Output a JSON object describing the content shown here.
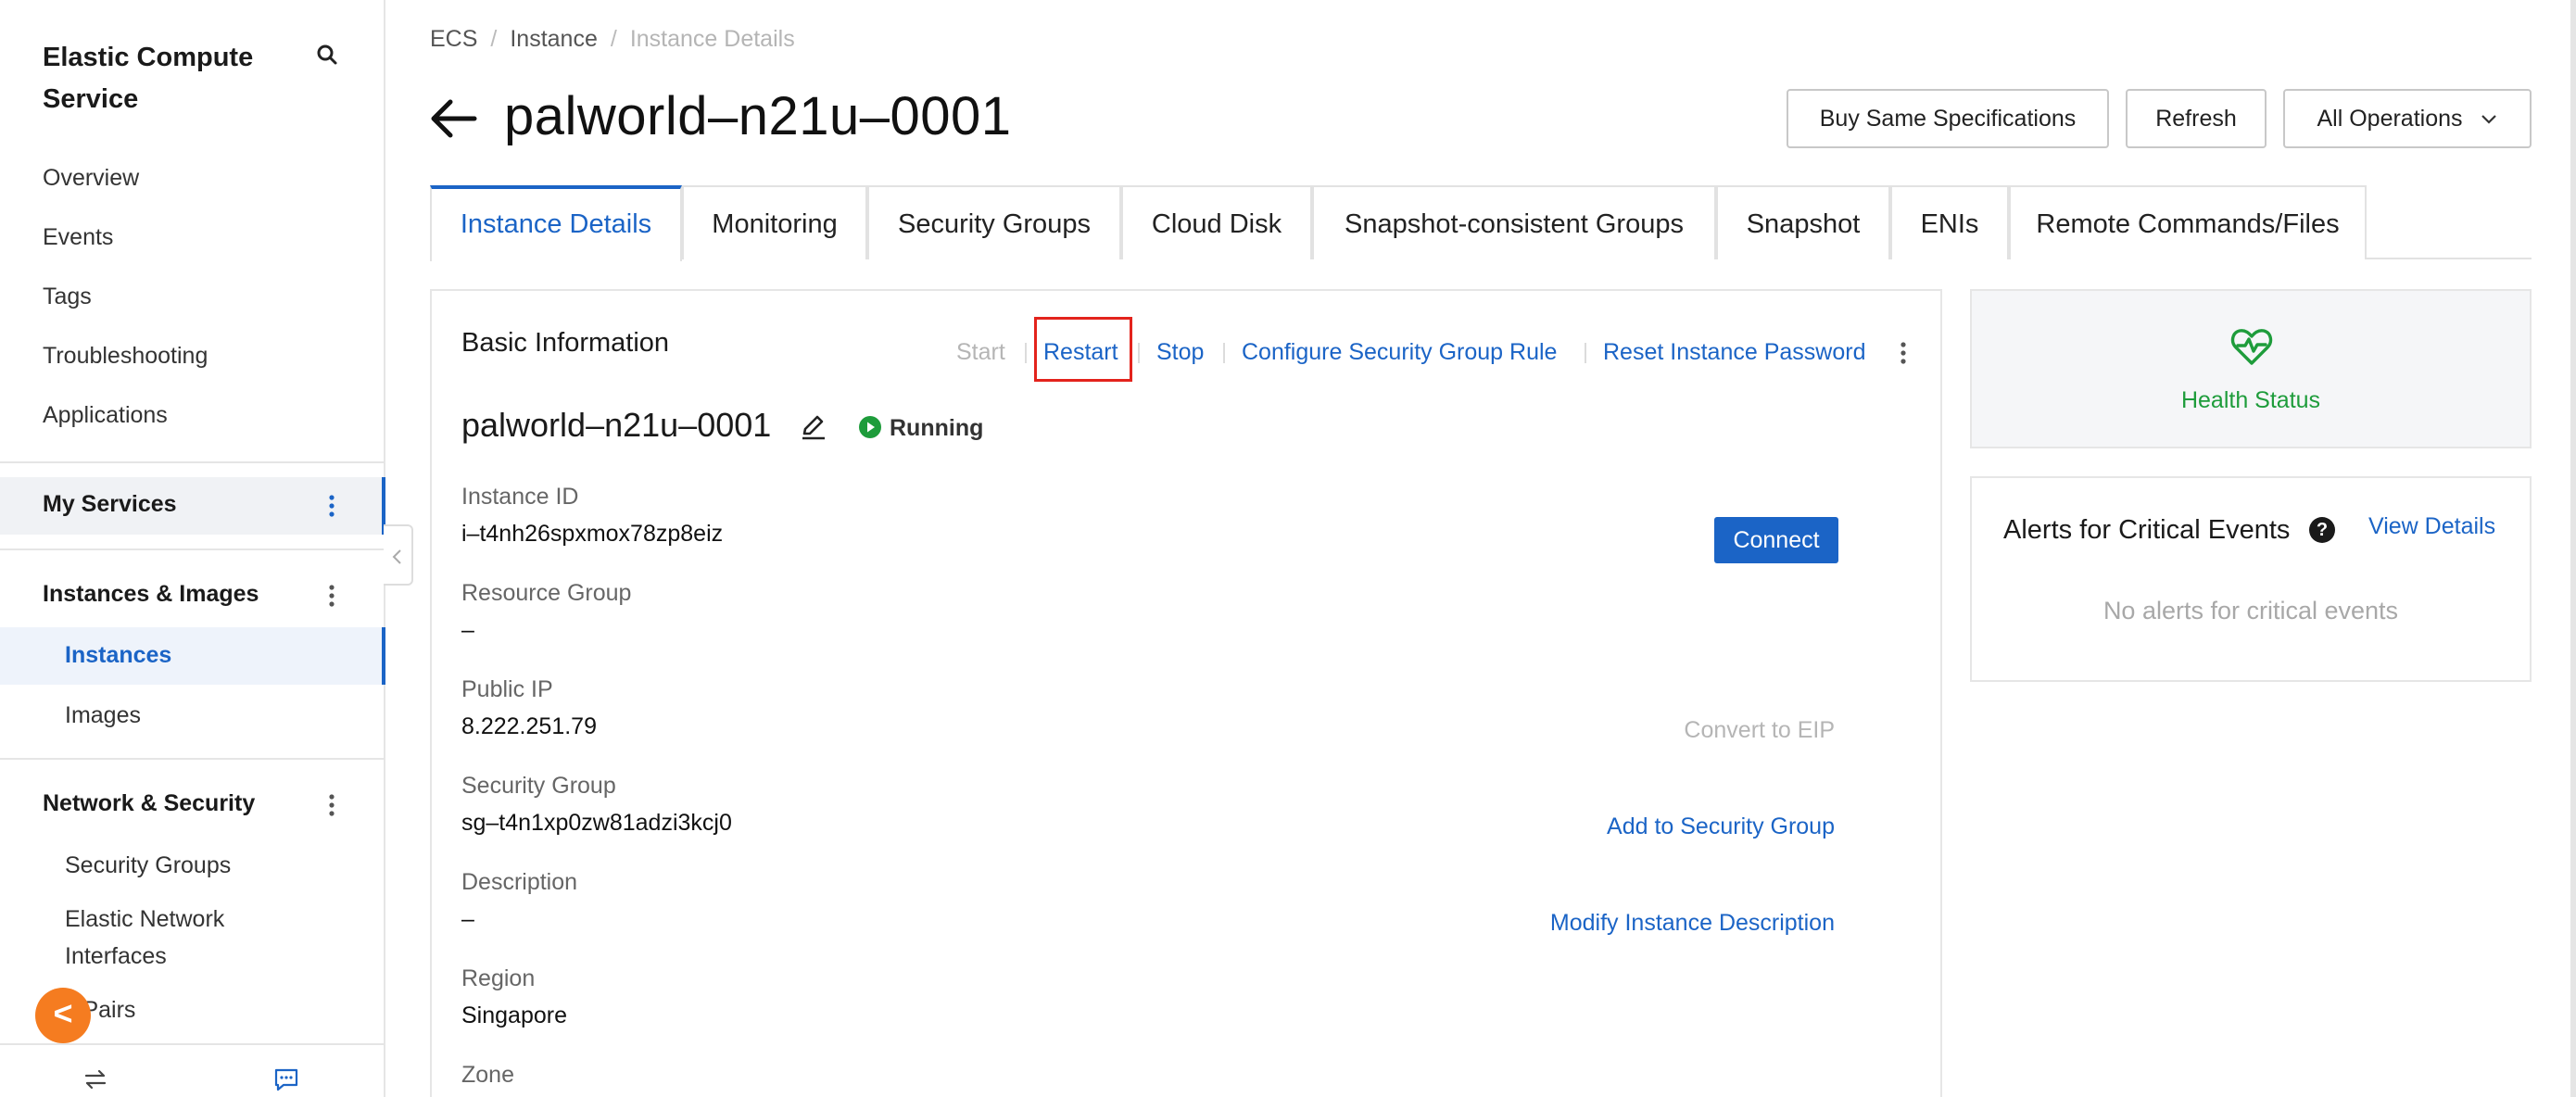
{
  "sidebar": {
    "title": "Elastic Compute Service",
    "links": [
      "Overview",
      "Events",
      "Tags",
      "Troubleshooting",
      "Applications"
    ],
    "my_services": "My Services",
    "instances_images": {
      "label": "Instances & Images",
      "items": [
        "Instances",
        "Images"
      ]
    },
    "network_security": {
      "label": "Network & Security",
      "items": [
        "Security Groups",
        "Elastic Network Interfaces",
        "Key Pairs"
      ],
      "partial_item_visible": "y Pairs"
    },
    "fab_label": "<"
  },
  "breadcrumb": [
    "ECS",
    "Instance",
    "Instance Details"
  ],
  "page_title": "palworld–n21u–0001",
  "header_buttons": {
    "buy_same": "Buy Same Specifications",
    "refresh": "Refresh",
    "all_operations": "All Operations"
  },
  "tabs": [
    {
      "label": "Instance Details",
      "active": true
    },
    {
      "label": "Monitoring",
      "active": false
    },
    {
      "label": "Security Groups",
      "active": false
    },
    {
      "label": "Cloud Disk",
      "active": false
    },
    {
      "label": "Snapshot-consistent Groups",
      "active": false
    },
    {
      "label": "Snapshot",
      "active": false
    },
    {
      "label": "ENIs",
      "active": false
    },
    {
      "label": "Remote Commands/Files",
      "active": false
    }
  ],
  "basic_info": {
    "title": "Basic Information",
    "actions": {
      "start": "Start",
      "restart": "Restart",
      "stop": "Stop",
      "configure_sg_rule": "Configure Security Group Rule",
      "reset_password": "Reset Instance Password"
    },
    "instance_name": "palworld–n21u–0001",
    "status": "Running",
    "fields": {
      "instance_id": {
        "label": "Instance ID",
        "value": "i–t4nh26spxmox78zp8eiz",
        "action": "Connect"
      },
      "resource_group": {
        "label": "Resource Group",
        "value": "–"
      },
      "public_ip": {
        "label": "Public IP",
        "value": "8.222.251.79",
        "action": "Convert to EIP"
      },
      "security_group": {
        "label": "Security Group",
        "value": "sg–t4n1xp0zw81adzi3kcj0",
        "action": "Add to Security Group"
      },
      "description": {
        "label": "Description",
        "value": "–",
        "action": "Modify Instance Description"
      },
      "region": {
        "label": "Region",
        "value": "Singapore"
      },
      "zone": {
        "label": "Zone"
      }
    }
  },
  "health": {
    "label": "Health Status"
  },
  "alerts": {
    "title": "Alerts for Critical Events",
    "help": "?",
    "view_details": "View Details",
    "empty": "No alerts for critical events"
  },
  "colors": {
    "accent": "#1b64c6",
    "health_green": "#1e9c3b",
    "highlight_red": "#e3231c",
    "fab_orange": "#f57c20"
  },
  "icons": {
    "search": "search-icon",
    "back": "arrow-left-icon",
    "edit": "pencil-icon",
    "running": "play-circle-icon",
    "health": "heart-pulse-icon",
    "kebab": "kebab-icon",
    "chevron": "chevron-down-icon",
    "switch": "swap-icon",
    "chat": "chat-icon",
    "collapse": "chevron-left-icon"
  }
}
